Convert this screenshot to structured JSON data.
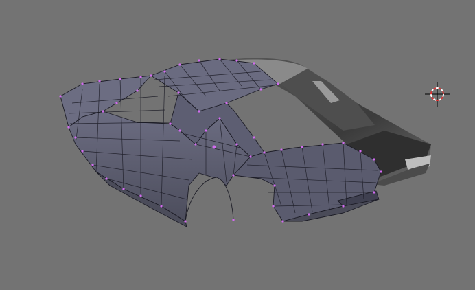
{
  "viewport": {
    "background": "#737373",
    "mesh_color": "#5f6072",
    "mesh_dark": "#4a4b58",
    "wire_color": "#1c1c26",
    "vertex_color": "#d26cf0",
    "shaded_light": "#6a6a6a",
    "shaded_dark": "#2f2f2f"
  },
  "cursor": {
    "name": "3d-cursor-icon",
    "ring_outer": "#e03030",
    "ring_inner": "#ffffff"
  }
}
